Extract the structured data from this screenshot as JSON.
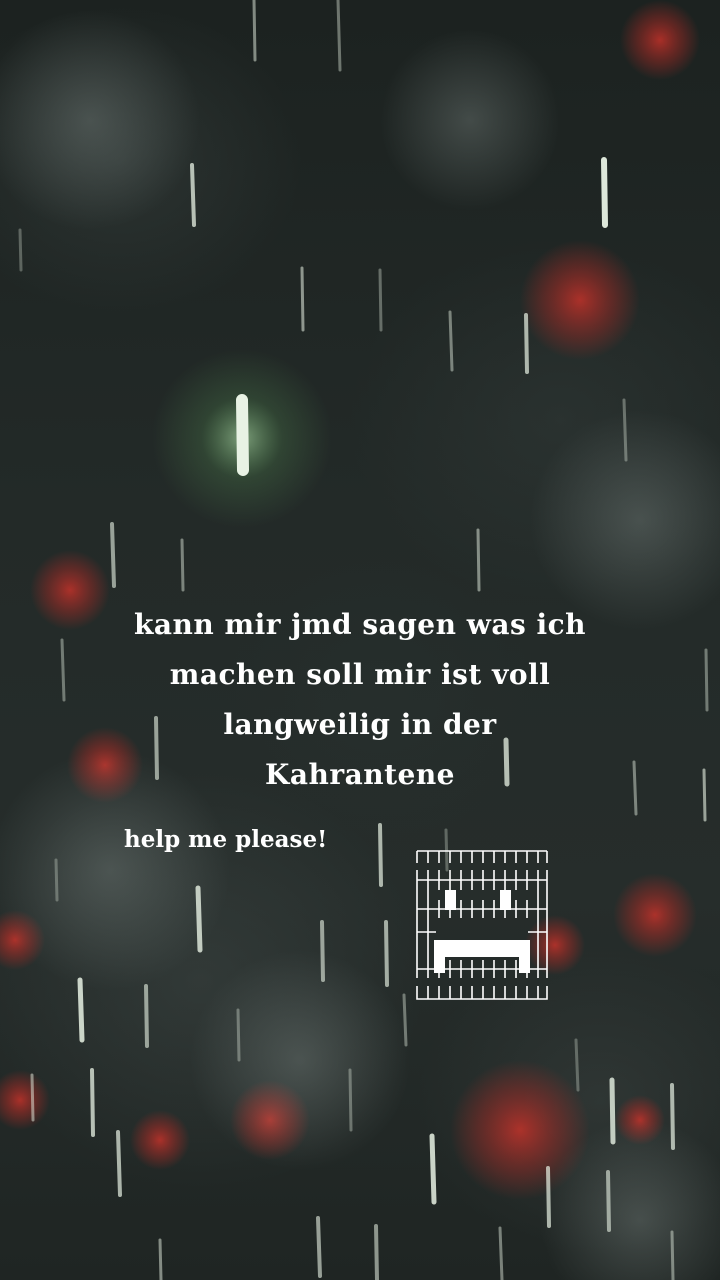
{
  "story": {
    "caption": "kann mir jmd sagen was ich\nmachen soll mir ist voll\nlangweilig in der\nKahrantene",
    "help_text": "help me please!",
    "text_art": {
      "icon": "grinning-face-text-art-icon",
      "rows": [
        "ᑎᑎᑎᑎᑎᑎᑎᑎᑎᑎᑎ",
        "ᕼᕼᕼᕼᕼᕼᕼᕼᕼᕼᕼ",
        "ᕼᕼ█ᕼᕼᕼᕼ█ᕼᕼᕼ",
        "ᕼᕼᕼᕼᕼᕼᕼᕼᕼᕼᕼ",
        "ᕼ█████████ᕼ",
        "ᕼ█ᕼᕼᕼᕼᕼᕼ█ᕼᕼ",
        "ᑌᑌᑌᑌᑌᑌᑌᑌᑌᑌᑌ"
      ]
    }
  },
  "background": {
    "scene": "rain-at-night-image",
    "colors": {
      "base": "#1e2422",
      "rain": "#e8f2e4",
      "glow": "#c8ffc0",
      "bokeh": "#c0302a"
    }
  }
}
